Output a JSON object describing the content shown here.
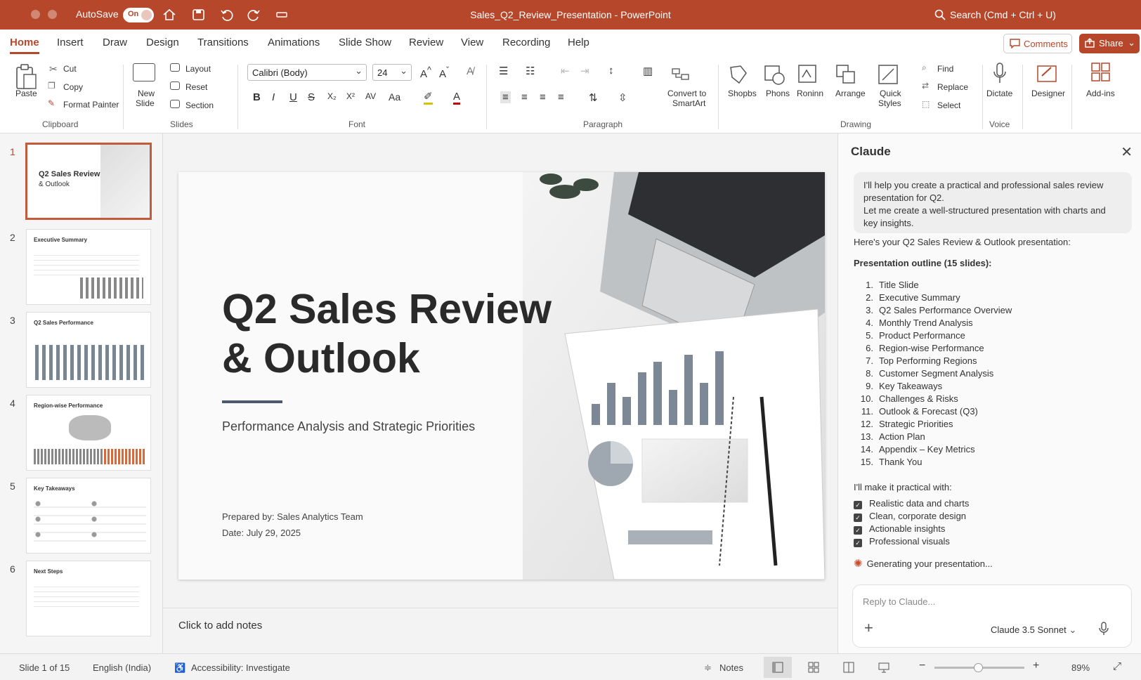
{
  "app": {
    "autosave_label": "AutoSave",
    "autosave_state": "On",
    "document_title": "Sales_Q2_Review_Presentation - PowerPoint",
    "search_placeholder": "Search (Cmd + Ctrl + U)"
  },
  "tabs": [
    "Home",
    "Insert",
    "Draw",
    "Design",
    "Transitions",
    "Animations",
    "Slide Show",
    "Review",
    "View",
    "Recording",
    "Help"
  ],
  "active_tab": "Home",
  "header_buttons": {
    "comments": "Comments",
    "share": "Share"
  },
  "ribbon": {
    "clipboard": {
      "paste": "Paste",
      "cut": "Cut",
      "copy": "Copy",
      "format_painter": "Format Painter",
      "group": "Clipboard"
    },
    "slides": {
      "new_slide_1": "New",
      "new_slide_2": "Slide",
      "layout": "Layout",
      "reset": "Reset",
      "section": "Section",
      "group": "Slides"
    },
    "font": {
      "family": "Calibri (Body)",
      "size": "24",
      "group": "Font"
    },
    "paragraph": {
      "convert_1": "Convert to",
      "convert_2": "SmartArt",
      "group": "Paragraph"
    },
    "drawing": {
      "shapes": "Shopbs",
      "photos": "Phons",
      "random": "Roninn",
      "arrange": "Arrange",
      "quick_1": "Quick",
      "quick_2": "Styles",
      "find": "Find",
      "replace": "Replace",
      "select": "Select",
      "group": "Drawing"
    },
    "voice": {
      "dictate": "Dictate",
      "group": "Voice"
    },
    "designer": "Designer",
    "addins": "Add-ins"
  },
  "thumbnails": [
    {
      "num": "1",
      "title_1": "Q2 Sales Review",
      "title_2": "& Outlook"
    },
    {
      "num": "2",
      "title": "Executive Summary"
    },
    {
      "num": "3",
      "title": "Q2 Sales Performance"
    },
    {
      "num": "4",
      "title": "Region-wise Performance"
    },
    {
      "num": "5",
      "title": "Key Takeaways"
    },
    {
      "num": "6",
      "title": "Next Steps"
    }
  ],
  "slide": {
    "title_line1": "Q2 Sales Review",
    "title_line2": "& Outlook",
    "subtitle": "Performance Analysis and Strategic Priorities",
    "prepared_label": "Prepared by:",
    "prepared_value": "Sales Analytics Team",
    "date_label": "Date:",
    "date_value": "July 29, 2025"
  },
  "notes_placeholder": "Click to add notes",
  "claude": {
    "title": "Claude",
    "bubble_line1": "I'll help you create a practical and professional sales review presentation for Q2.",
    "bubble_line2": "Let me create a well-structured presentation with charts and key insights.",
    "intro": "Here's your Q2 Sales Review & Outlook presentation:",
    "outline_heading": "Presentation outline (15 slides):",
    "outline": [
      "Title Slide",
      "Executive Summary",
      "Q2 Sales Performance Overview",
      "Monthly Trend Analysis",
      "Product Performance",
      "Region-wise Performance",
      "Top Performing Regions",
      "Customer Segment Analysis",
      "Key Takeaways",
      "Challenges & Risks",
      "Outlook & Forecast (Q3)",
      "Strategic Priorities",
      "Action Plan",
      "Appendix – Key Metrics",
      "Thank You"
    ],
    "practical_heading": "I'll make it practical with:",
    "checklist": [
      "Realistic data and charts",
      "Clean, corporate design",
      "Actionable insights",
      "Professional visuals"
    ],
    "generating": "Generating your presentation...",
    "reply_placeholder": "Reply to Claude...",
    "model": "Claude 3.5 Sonnet"
  },
  "status": {
    "slide_count": "Slide 1 of 15",
    "language": "English (India)",
    "accessibility": "Accessibility: Investigate",
    "notes": "Notes",
    "zoom": "89%"
  },
  "colors": {
    "accent": "#b7472a",
    "slide_rule": "#4a5a6a"
  }
}
